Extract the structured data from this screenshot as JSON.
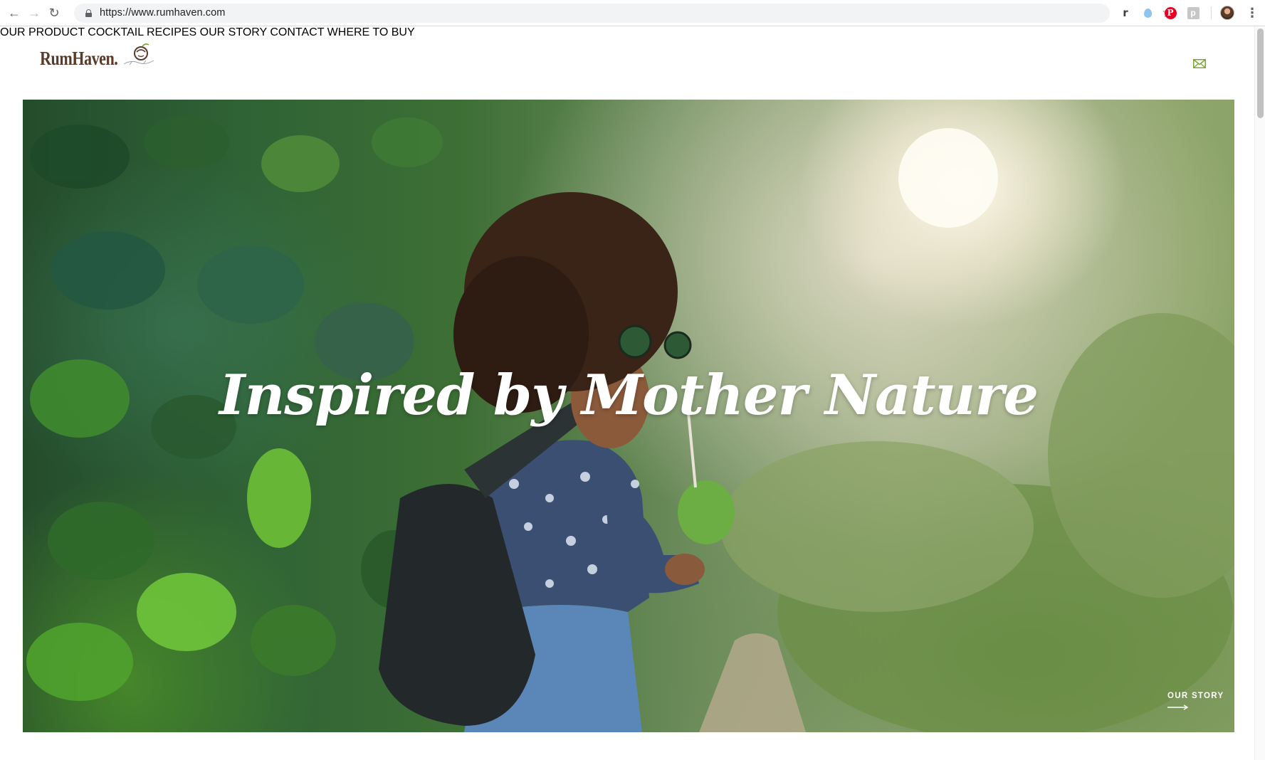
{
  "browser": {
    "url": "https://www.rumhaven.com",
    "extension_r": "r",
    "extension_pinterest": "P",
    "extension_p": "p"
  },
  "site": {
    "logo_text": "RumHaven."
  },
  "nav": {
    "items": [
      {
        "label": "OUR PRODUCT"
      },
      {
        "label": "COCKTAIL RECIPES"
      },
      {
        "label": "OUR STORY"
      },
      {
        "label": "CONTACT"
      },
      {
        "label": "WHERE TO BUY"
      }
    ]
  },
  "hero": {
    "headline": "Inspired by Mother Nature",
    "link_label": "OUR STORY"
  },
  "colors": {
    "accent_green": "#7da437",
    "logo_brown": "#5a3a2a"
  },
  "icons": [
    "back-arrow-icon",
    "forward-arrow-icon",
    "reload-icon",
    "lock-icon",
    "bookmark-star-icon",
    "mail-icon",
    "arrow-right-icon"
  ]
}
